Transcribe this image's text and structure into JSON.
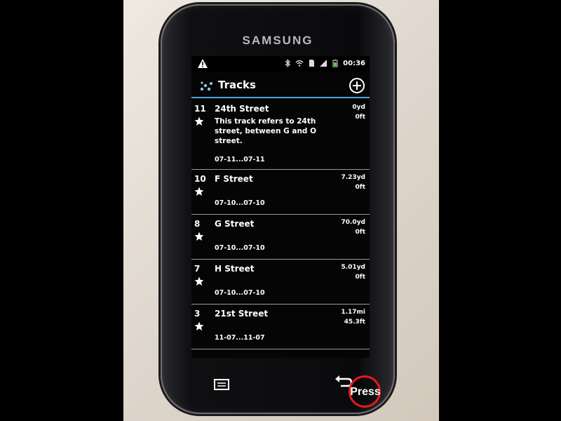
{
  "device": {
    "brand": "SAMSUNG"
  },
  "status_bar": {
    "time": "00:36",
    "icons": [
      "warning-icon",
      "bluetooth-icon",
      "wifi-icon",
      "sim-icon",
      "signal-icon",
      "battery-icon"
    ]
  },
  "app": {
    "title": "Tracks",
    "icon": "footprints-icon",
    "add_icon": "add-track-icon"
  },
  "tracks": [
    {
      "number": "11",
      "name": "24th Street",
      "description": "This track refers to 24th street, between G and O street.",
      "date": "07-11...07-11",
      "distance": "0yd",
      "elevation": "0ft"
    },
    {
      "number": "10",
      "name": "F Street",
      "description": "",
      "date": "07-10...07-10",
      "distance": "7.23yd",
      "elevation": "0ft"
    },
    {
      "number": "8",
      "name": "G Street",
      "description": "",
      "date": "07-10...07-10",
      "distance": "70.0yd",
      "elevation": "0ft"
    },
    {
      "number": "7",
      "name": "H Street",
      "description": "",
      "date": "07-10...07-10",
      "distance": "5.01yd",
      "elevation": "0ft"
    },
    {
      "number": "3",
      "name": "21st Street",
      "description": "",
      "date": "11-07...11-07",
      "distance": "1.17mi",
      "elevation": "45.3ft"
    }
  ],
  "overlay": {
    "press_label": "Press"
  },
  "colors": {
    "accent": "#4aa8d8",
    "press_ring": "#e41b1b",
    "battery": "#59c94a"
  }
}
